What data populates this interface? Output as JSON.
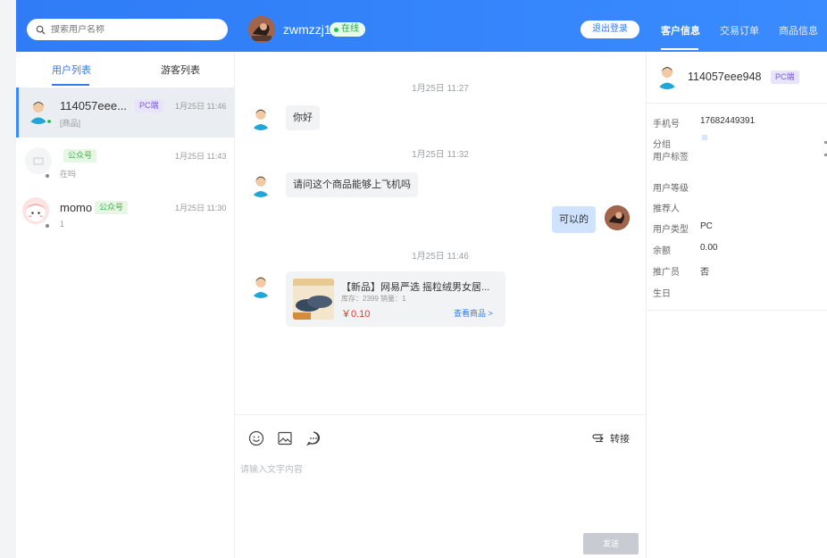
{
  "search": {
    "placeholder": "搜索用户名称"
  },
  "agent": {
    "name": "zwmzzj1",
    "status": "在线"
  },
  "header": {
    "logout_label": "退出登录",
    "tabs": [
      "客户信息",
      "交易订单",
      "商品信息"
    ]
  },
  "left_tabs": [
    "用户列表",
    "游客列表"
  ],
  "conversations": [
    {
      "name": "114057eee...",
      "badge": "PC端",
      "sub": "[商品]",
      "time": "1月25日 11:46"
    },
    {
      "name": "",
      "badge": "公众号",
      "sub": "在吗",
      "time": "1月25日 11:43"
    },
    {
      "name": "momo",
      "badge": "公众号",
      "sub": "1",
      "time": "1月25日 11:30"
    }
  ],
  "messages": {
    "t1": "1月25日 11:27",
    "m1": "你好",
    "t2": "1月25日 11:32",
    "m2": "请问这个商品能够上飞机吗",
    "m3": "可以的",
    "t3": "1月25日 11:46",
    "card": {
      "title": "【新品】网易严选 摇粒绒男女居...",
      "stock": "库存：2399 销量：1",
      "price": "￥0.10",
      "view": "查看商品 >"
    }
  },
  "compose": {
    "transfer_label": "转接",
    "placeholder": "请输入文字内容",
    "send_label": "发送"
  },
  "customer": {
    "name": "114057eee948",
    "badge": "PC端",
    "fields": [
      {
        "label": "手机号",
        "value": "17682449391"
      },
      {
        "label": "分组",
        "value": ""
      },
      {
        "label": "用户标签",
        "value": ""
      },
      {
        "label": "用户等级",
        "value": ""
      },
      {
        "label": "推荐人",
        "value": ""
      },
      {
        "label": "用户类型",
        "value": "PC"
      },
      {
        "label": "余额",
        "value": "0.00"
      },
      {
        "label": "推广员",
        "value": "否"
      },
      {
        "label": "生日",
        "value": ""
      }
    ]
  },
  "colors": {
    "primary": "#2f7cf6",
    "online": "#27c24c",
    "price": "#e5392f",
    "pc_badge": "#7a5ce0",
    "gzh_badge": "#3bb34a"
  }
}
